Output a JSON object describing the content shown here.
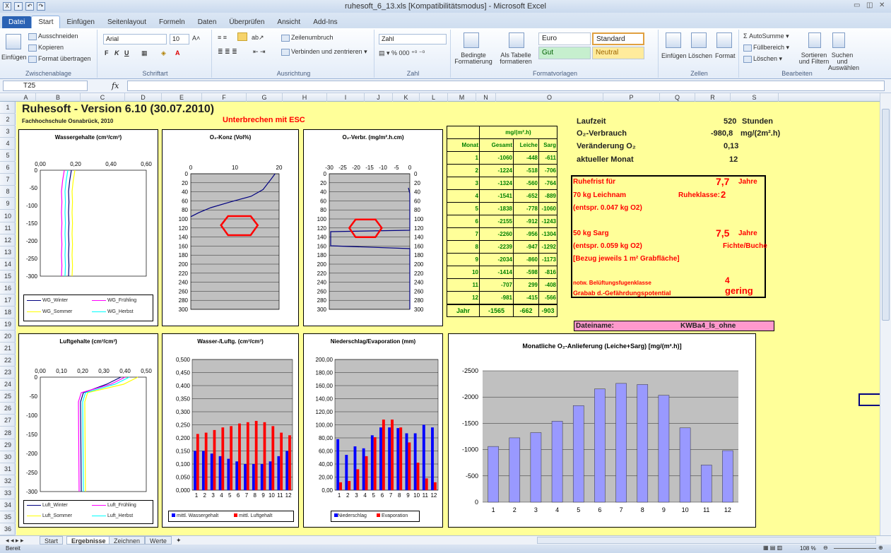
{
  "window": {
    "title": "ruhesoft_6_13.xls  [Kompatibilitätsmodus]  -  Microsoft Excel"
  },
  "ribbon_tabs": [
    "Datei",
    "Start",
    "Einfügen",
    "Seitenlayout",
    "Formeln",
    "Daten",
    "Überprüfen",
    "Ansicht",
    "Add-Ins"
  ],
  "ribbon": {
    "clipboard": {
      "paste": "Einfügen",
      "cut": "Ausschneiden",
      "copy": "Kopieren",
      "format_painter": "Format übertragen",
      "group": "Zwischenablage"
    },
    "font": {
      "name": "Arial",
      "size": "10",
      "group": "Schriftart"
    },
    "alignment": {
      "wrap": "Zeilenumbruch",
      "merge": "Verbinden und zentrieren",
      "group": "Ausrichtung"
    },
    "number": {
      "format": "Zahl",
      "group": "Zahl"
    },
    "styles": {
      "conditional": "Bedingte Formatierung",
      "as_table": "Als Tabelle formatieren",
      "euro": "Euro",
      "standard": "Standard",
      "gut": "Gut",
      "neutral": "Neutral",
      "group": "Formatvorlagen"
    },
    "cells": {
      "insert": "Einfügen",
      "delete": "Löschen",
      "format": "Format",
      "group": "Zellen"
    },
    "editing": {
      "autosum": "AutoSumme",
      "fill": "Füllbereich",
      "clear": "Löschen",
      "sort": "Sortieren und Filtern",
      "find": "Suchen und Auswählen",
      "group": "Bearbeiten"
    }
  },
  "formula_bar": {
    "name_box": "T25",
    "fx": "fx"
  },
  "columns": [
    "A",
    "B",
    "C",
    "D",
    "E",
    "F",
    "G",
    "H",
    "I",
    "J",
    "K",
    "L",
    "M",
    "N",
    "O",
    "P",
    "Q",
    "R",
    "S"
  ],
  "rows": [
    "1",
    "2",
    "3",
    "4",
    "5",
    "6",
    "7",
    "8",
    "9",
    "10",
    "11",
    "12",
    "13",
    "14",
    "15",
    "16",
    "17",
    "18",
    "19",
    "20",
    "21",
    "22",
    "23",
    "24",
    "25",
    "26",
    "27",
    "28",
    "29",
    "30",
    "31",
    "32",
    "33",
    "34",
    "35",
    "36"
  ],
  "sheet": {
    "title": "Ruhesoft - Version 6.10 (30.07.2010)",
    "subtitle": "Fachhochschule Osnabrück, 2010",
    "interrupt": "Unterbrechen mit ESC",
    "info": {
      "laufzeit_label": "Laufzeit",
      "laufzeit_value": "520",
      "laufzeit_unit": "Stunden",
      "o2_label": "O₂-Verbrauch",
      "o2_value": "-980,8",
      "o2_unit": "mg/(2m².h)",
      "change_label": "Veränderung O₂",
      "change_value": "0,13",
      "month_label": "aktueller Monat",
      "month_value": "12"
    },
    "rest": {
      "line1_label": "Ruhefrist für",
      "line1_value": "7,7",
      "line1_unit": "Jahre",
      "line2": "70 kg Leichnam",
      "ruheklasse_label": "Ruheklasse:",
      "ruheklasse_value": "2",
      "line3": "(entspr. 0.047 kg O2)",
      "line4_label": "50 kg Sarg",
      "line4_value": "7,5",
      "line4_unit": "Jahre",
      "line5": "(entspr. 0.059 kg O2)",
      "wood": "Fichte/Buche",
      "line6": "[Bezug jeweils 1 m² Grabfläche]",
      "vent_label": "notw. Belüftungsfugenklasse",
      "vent_value": "4",
      "hazard_label": "Grabab d.-Gefährdungspotential",
      "hazard_value": "gering"
    },
    "file": {
      "label": "Dateiname:",
      "value": "KWBa4_ls_ohne"
    },
    "table": {
      "unit": "mg/(m².h)",
      "headers": [
        "Monat",
        "Gesamt",
        "Leiche",
        "Sarg"
      ],
      "rows": [
        [
          "1",
          "-1060",
          "-448",
          "-611"
        ],
        [
          "2",
          "-1224",
          "-518",
          "-706"
        ],
        [
          "3",
          "-1324",
          "-560",
          "-764"
        ],
        [
          "4",
          "-1541",
          "-652",
          "-889"
        ],
        [
          "5",
          "-1838",
          "-778",
          "-1060"
        ],
        [
          "6",
          "-2155",
          "-912",
          "-1243"
        ],
        [
          "7",
          "-2260",
          "-956",
          "-1304"
        ],
        [
          "8",
          "-2239",
          "-947",
          "-1292"
        ],
        [
          "9",
          "-2034",
          "-860",
          "-1173"
        ],
        [
          "10",
          "-1414",
          "-598",
          "-816"
        ],
        [
          "11",
          "-707",
          "299",
          "-408"
        ],
        [
          "12",
          "-981",
          "-415",
          "-566"
        ]
      ],
      "total": [
        "Jahr",
        "-1565",
        "-662",
        "-903"
      ]
    }
  },
  "charts": {
    "wg": {
      "title": "Wassergehalte (cm³/cm³)",
      "xticks": [
        "0,00",
        "0,20",
        "0,40",
        "0,60"
      ],
      "yticks": [
        "0",
        "-50",
        "-100",
        "-150",
        "-200",
        "-250",
        "-300"
      ],
      "legend": [
        "WG_Winter",
        "WG_Frühling",
        "WG_Sommer",
        "WG_Herbst"
      ],
      "colors": [
        "#000080",
        "#ff00ff",
        "#ffff00",
        "#00ffff"
      ]
    },
    "o2k": {
      "title": "O₂-Konz (Vol%)",
      "xticks": [
        "0",
        "10",
        "20"
      ],
      "yticks": [
        "0",
        "20",
        "40",
        "60",
        "80",
        "100",
        "120",
        "140",
        "160",
        "180",
        "200",
        "220",
        "240",
        "260",
        "280",
        "300"
      ]
    },
    "o2v": {
      "title": "O₂-Verbr. (mg/m².h.cm)",
      "xticks": [
        "-30",
        "-25",
        "-20",
        "-15",
        "-10",
        "-5",
        "0"
      ],
      "yticks": [
        "0",
        "20",
        "40",
        "60",
        "80",
        "100",
        "120",
        "140",
        "160",
        "180",
        "200",
        "220",
        "240",
        "260",
        "280",
        "300"
      ]
    },
    "lg": {
      "title": "Luftgehalte (cm³/cm³)",
      "xticks": [
        "0,00",
        "0,10",
        "0,20",
        "0,30",
        "0,40",
        "0,50"
      ],
      "yticks": [
        "0",
        "-50",
        "-100",
        "-150",
        "-200",
        "-250",
        "-300"
      ],
      "legend": [
        "Luft_Winter",
        "Luft_Frühling",
        "Luft_Sommer",
        "Luft_Herbst"
      ],
      "colors": [
        "#000080",
        "#ff00ff",
        "#ffff00",
        "#00ffff"
      ]
    },
    "wl": {
      "title": "Wasser-/Luftg. (cm³/cm³)",
      "yticks": [
        "0,500",
        "0,450",
        "0,400",
        "0,350",
        "0,300",
        "0,250",
        "0,200",
        "0,150",
        "0,100",
        "0,050",
        "0,000"
      ],
      "categories": [
        "1",
        "2",
        "3",
        "4",
        "5",
        "6",
        "7",
        "8",
        "9",
        "10",
        "11",
        "12"
      ],
      "series": [
        {
          "name": "mittl. Wassergehalt",
          "color": "#0000ff",
          "values": [
            0.15,
            0.15,
            0.14,
            0.13,
            0.12,
            0.11,
            0.1,
            0.1,
            0.1,
            0.11,
            0.13,
            0.15
          ]
        },
        {
          "name": "mittl. Luftgehalt",
          "color": "#ff0000",
          "values": [
            0.215,
            0.22,
            0.23,
            0.24,
            0.245,
            0.255,
            0.26,
            0.265,
            0.26,
            0.245,
            0.22,
            0.21
          ]
        }
      ]
    },
    "ne": {
      "title": "Niederschlag/Evaporation (mm)",
      "yticks": [
        "200,00",
        "180,00",
        "160,00",
        "140,00",
        "120,00",
        "100,00",
        "80,00",
        "60,00",
        "40,00",
        "20,00",
        "0,00"
      ],
      "categories": [
        "1",
        "2",
        "3",
        "4",
        "5",
        "6",
        "7",
        "8",
        "9",
        "10",
        "11",
        "12"
      ],
      "series": [
        {
          "name": "Niederschlag",
          "color": "#0000ff",
          "values": [
            78,
            54,
            67,
            64,
            84,
            96,
            96,
            95,
            87,
            87,
            100,
            96
          ]
        },
        {
          "name": "Evaporation",
          "color": "#ff0000",
          "values": [
            12,
            14,
            32,
            52,
            81,
            108,
            108,
            96,
            73,
            42,
            18,
            12
          ]
        }
      ]
    },
    "ml": {
      "title": "Monatliche O₂-Anlieferung (Leiche+Sarg) [mg/(m².h)]",
      "yticks": [
        "-2500",
        "-2000",
        "-1500",
        "-1000",
        "-500",
        "0"
      ],
      "categories": [
        "1",
        "2",
        "3",
        "4",
        "5",
        "6",
        "7",
        "8",
        "9",
        "10",
        "11",
        "12"
      ],
      "values": [
        -1060,
        -1224,
        -1324,
        -1541,
        -1838,
        -2155,
        -2260,
        -2239,
        -2034,
        -1414,
        -707,
        -981
      ],
      "color": "#9999ff"
    }
  },
  "chart_data": [
    {
      "type": "bar",
      "title": "Wasser-/Luftg. (cm³/cm³)",
      "categories": [
        "1",
        "2",
        "3",
        "4",
        "5",
        "6",
        "7",
        "8",
        "9",
        "10",
        "11",
        "12"
      ],
      "ylim": [
        0,
        0.5
      ],
      "series": [
        {
          "name": "mittl. Wassergehalt",
          "values": [
            0.15,
            0.15,
            0.14,
            0.13,
            0.12,
            0.11,
            0.1,
            0.1,
            0.1,
            0.11,
            0.13,
            0.15
          ]
        },
        {
          "name": "mittl. Luftgehalt",
          "values": [
            0.215,
            0.22,
            0.23,
            0.24,
            0.245,
            0.255,
            0.26,
            0.265,
            0.26,
            0.245,
            0.22,
            0.21
          ]
        }
      ]
    },
    {
      "type": "bar",
      "title": "Niederschlag/Evaporation (mm)",
      "categories": [
        "1",
        "2",
        "3",
        "4",
        "5",
        "6",
        "7",
        "8",
        "9",
        "10",
        "11",
        "12"
      ],
      "ylim": [
        0,
        200
      ],
      "series": [
        {
          "name": "Niederschlag",
          "values": [
            78,
            54,
            67,
            64,
            84,
            96,
            96,
            95,
            87,
            87,
            100,
            96
          ]
        },
        {
          "name": "Evaporation",
          "values": [
            12,
            14,
            32,
            52,
            81,
            108,
            108,
            96,
            73,
            42,
            18,
            12
          ]
        }
      ]
    },
    {
      "type": "bar",
      "title": "Monatliche O₂-Anlieferung (Leiche+Sarg) [mg/(m².h)]",
      "categories": [
        "1",
        "2",
        "3",
        "4",
        "5",
        "6",
        "7",
        "8",
        "9",
        "10",
        "11",
        "12"
      ],
      "ylim": [
        0,
        -2500
      ],
      "series": [
        {
          "values": [
            -1060,
            -1224,
            -1324,
            -1541,
            -1838,
            -2155,
            -2260,
            -2239,
            -2034,
            -1414,
            -707,
            -981
          ]
        }
      ]
    }
  ],
  "sheet_tabs": [
    "Start",
    "Ergebnisse",
    "Zeichnen",
    "Werte"
  ],
  "status": {
    "ready": "Bereit",
    "zoom": "108 %"
  }
}
